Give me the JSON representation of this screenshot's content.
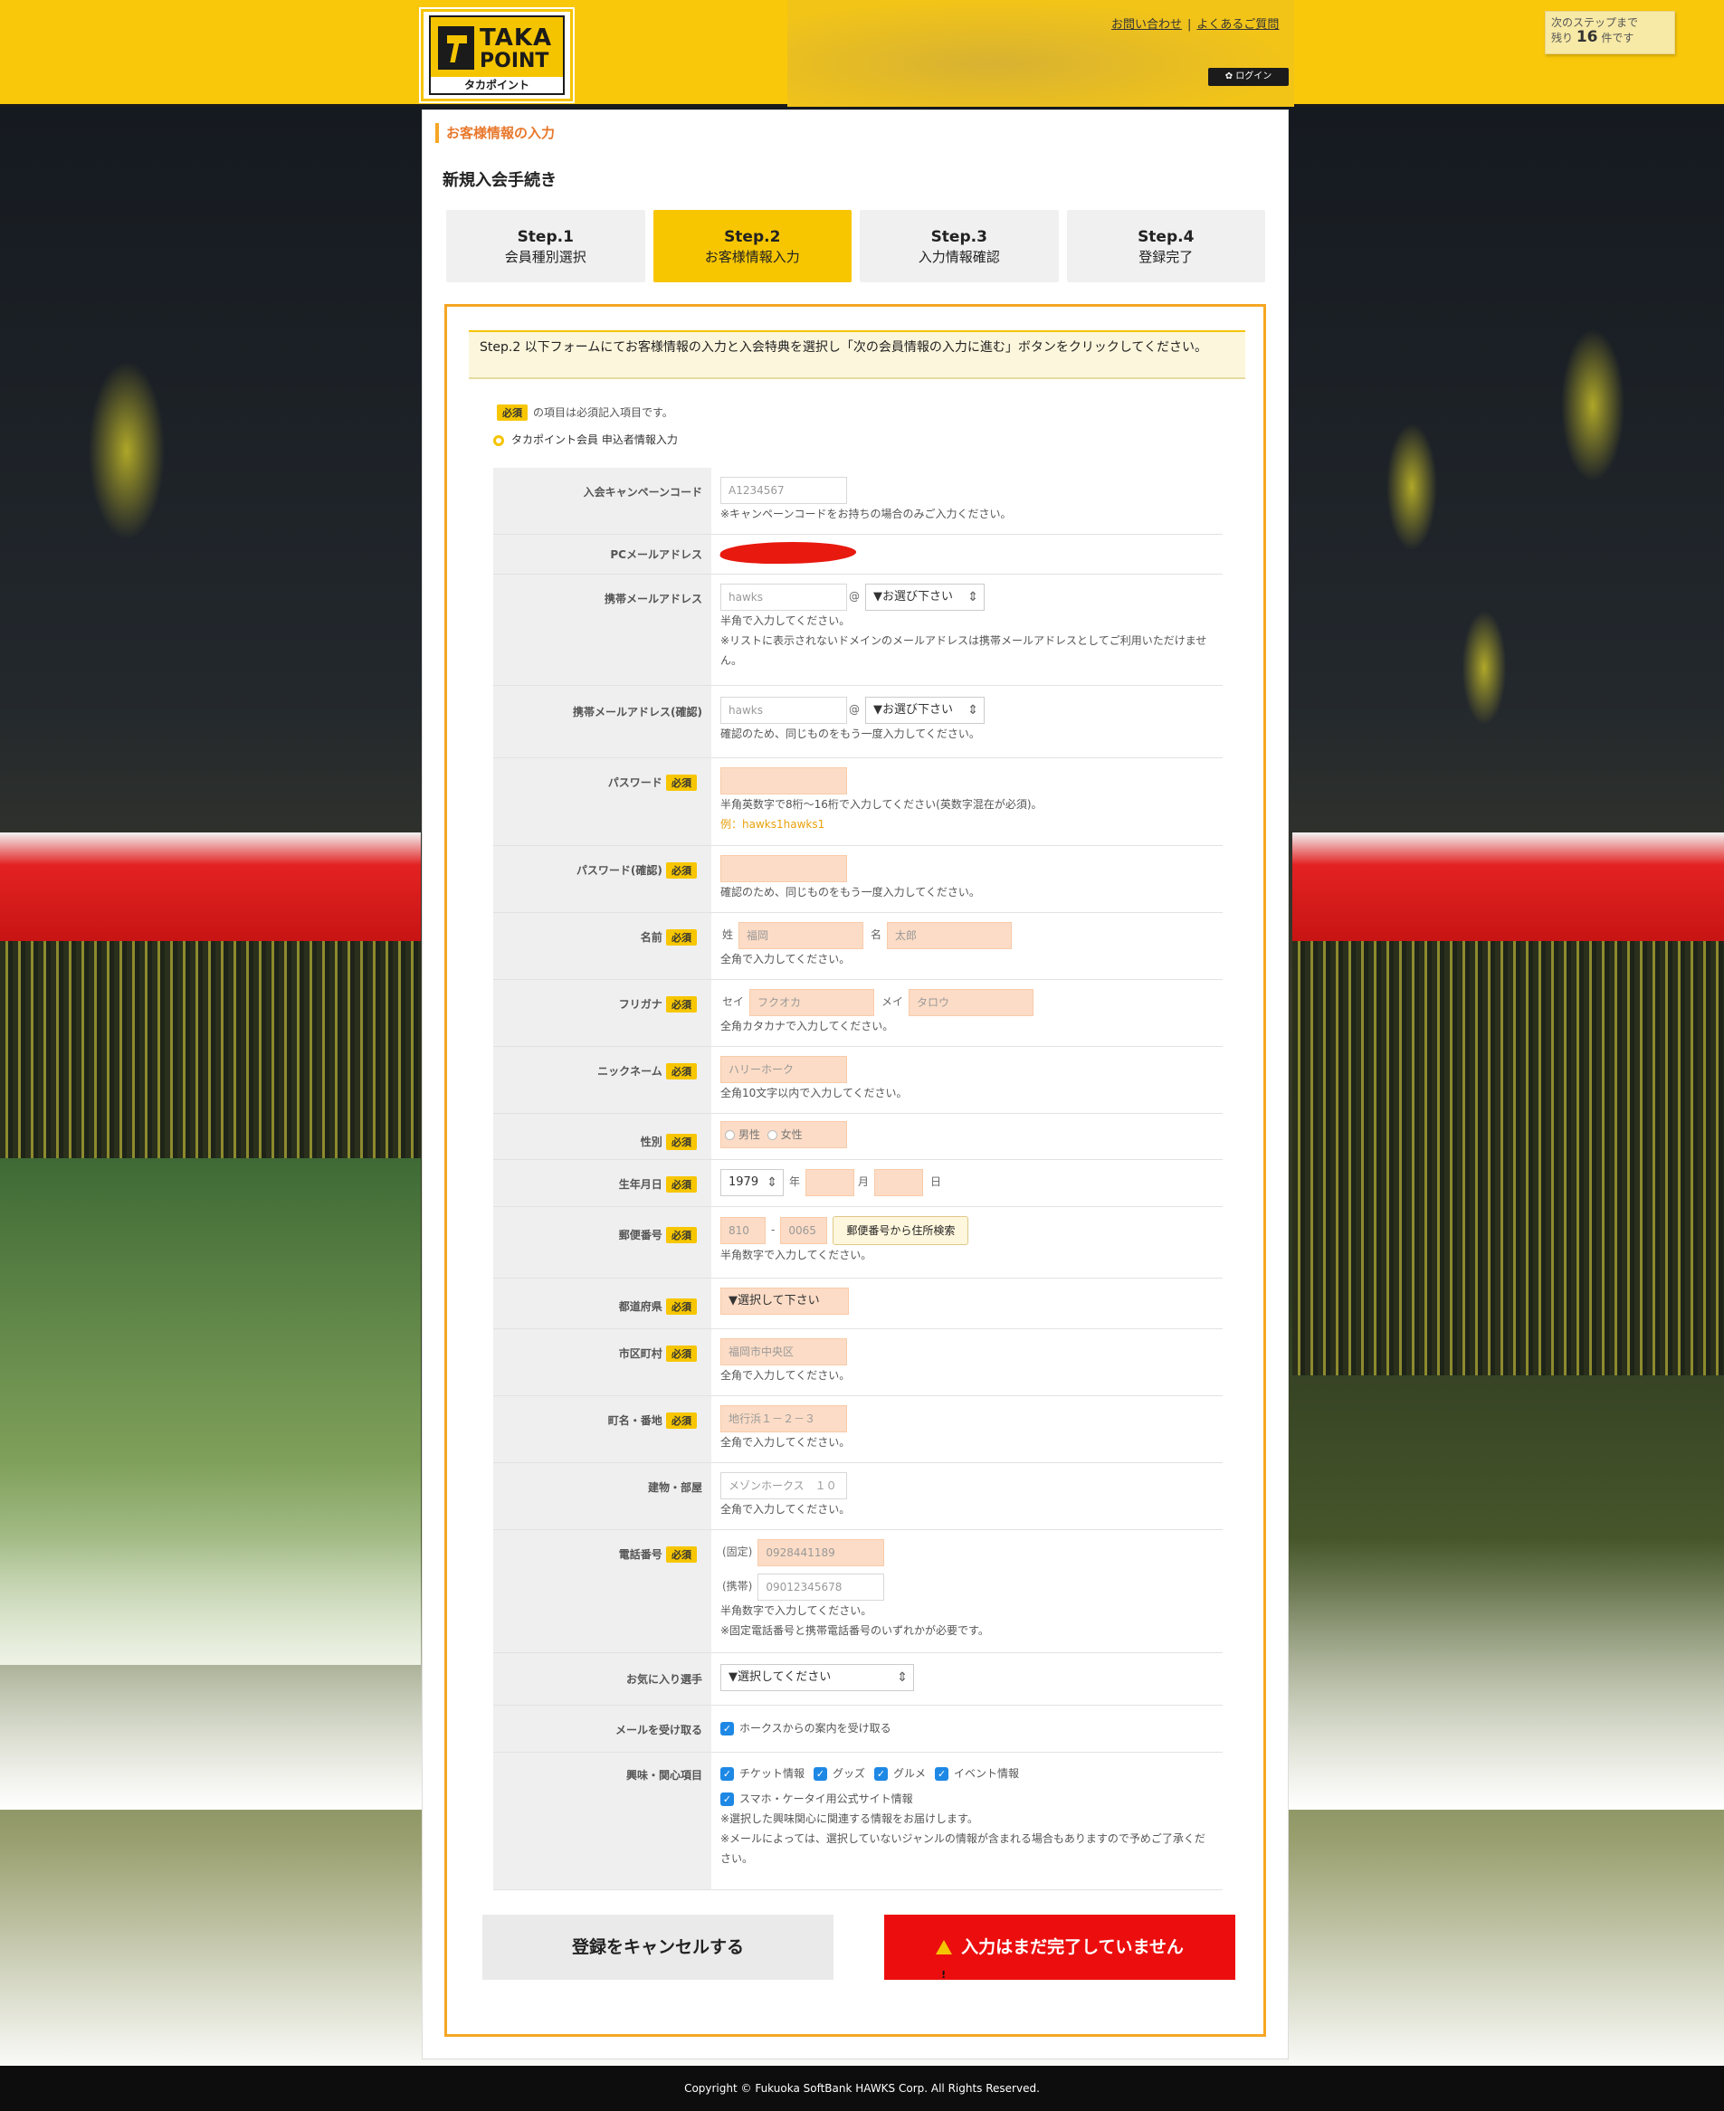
{
  "header": {
    "logo_line1": "TAKA",
    "logo_line2": "POINT",
    "logo_sub": "タカポイント",
    "link_contact": "お問い合わせ",
    "link_faq": "よくあるご質問",
    "login": "ログイン",
    "steps_note_pre": "次のステップまで",
    "steps_note_mid": "残り",
    "steps_note_num": "16",
    "steps_note_post": "件です"
  },
  "breadcrumb": "お客様情報の入力",
  "page_title": "新規入会手続き",
  "tabs": [
    {
      "step": "Step.1",
      "label": "会員種別選択",
      "active": false
    },
    {
      "step": "Step.2",
      "label": "お客様情報入力",
      "active": true
    },
    {
      "step": "Step.3",
      "label": "入力情報確認",
      "active": false
    },
    {
      "step": "Step.4",
      "label": "登録完了",
      "active": false
    }
  ],
  "info_text": "Step.2 以下フォームにてお客様情報の入力と入会特典を選択し「次の会員情報の入力に進む」ボタンをクリックしてください。",
  "required_badge": "必須",
  "required_note": "の項目は必須記入項目です。",
  "section_head": "タカポイント会員 申込者情報入力",
  "fields": {
    "campaign": {
      "label": "入会キャンペーンコード",
      "placeholder": "A1234567",
      "hint": "※キャンペーンコードをお持ちの場合のみご入力ください。"
    },
    "pc_mail": {
      "label": "PCメールアドレス"
    },
    "mobile_mail": {
      "label": "携帯メールアドレス",
      "placeholder": "hawks",
      "at": "@",
      "domain": "▼お選び下さい",
      "hint1": "半角で入力してください。",
      "hint2": "※リストに表示されないドメインのメールアドレスは携帯メールアドレスとしてご利用いただけません。"
    },
    "mobile_mail_confirm": {
      "label": "携帯メールアドレス(確認)",
      "placeholder": "hawks",
      "at": "@",
      "domain": "▼お選び下さい",
      "hint": "確認のため、同じものをもう一度入力してください。"
    },
    "password": {
      "label": "パスワード",
      "hint": "半角英数字で8桁〜16桁で入力してください(英数字混在が必須)。",
      "example": "例：hawks1hawks1"
    },
    "password_confirm": {
      "label": "パスワード(確認)",
      "hint": "確認のため、同じものをもう一度入力してください。"
    },
    "name": {
      "label": "名前",
      "sei": "姓",
      "sei_ph": "福岡",
      "mei": "名",
      "mei_ph": "太郎",
      "hint": "全角で入力してください。"
    },
    "kana": {
      "label": "フリガナ",
      "sei": "セイ",
      "sei_ph": "フクオカ",
      "mei": "メイ",
      "mei_ph": "タロウ",
      "hint": "全角カタカナで入力してください。"
    },
    "nickname": {
      "label": "ニックネーム",
      "placeholder": "ハリーホーク",
      "hint": "全角10文字以内で入力してください。"
    },
    "gender": {
      "label": "性別",
      "male": "男性",
      "female": "女性"
    },
    "birthday": {
      "label": "生年月日",
      "year": "1979",
      "year_unit": "年",
      "month_unit": "月",
      "day_unit": "日"
    },
    "zip": {
      "label": "郵便番号",
      "ph1": "810",
      "dash": "-",
      "ph2": "0065",
      "button": "郵便番号から住所検索",
      "hint": "半角数字で入力してください。"
    },
    "pref": {
      "label": "都道府県",
      "value": "▼選択して下さい"
    },
    "city": {
      "label": "市区町村",
      "placeholder": "福岡市中央区",
      "hint": "全角で入力してください。"
    },
    "street": {
      "label": "町名・番地",
      "placeholder": "地行浜１－２－３",
      "hint": "全角で入力してください。"
    },
    "building": {
      "label": "建物・部屋",
      "placeholder": "メゾンホークス　１０",
      "hint": "全角で入力してください。"
    },
    "phone": {
      "label": "電話番号",
      "fixed": "(固定)",
      "fixed_ph": "0928441189",
      "mobile": "(携帯)",
      "mobile_ph": "09012345678",
      "hint1": "半角数字で入力してください。",
      "hint2": "※固定電話番号と携帯電話番号のいずれかが必要です。"
    },
    "favorite": {
      "label": "お気に入り選手",
      "value": "▼選択してください"
    },
    "mail_receive": {
      "label": "メールを受け取る",
      "option": "ホークスからの案内を受け取る"
    },
    "interests": {
      "label": "興味・関心項目",
      "options": [
        "チケット情報",
        "グッズ",
        "グルメ",
        "イベント情報",
        "スマホ・ケータイ用公式サイト情報"
      ],
      "hint1": "※選択した興味関心に関連する情報をお届けします。",
      "hint2": "※メールによっては、選択していないジャンルの情報が含まれる場合もありますので予めご了承ください。"
    }
  },
  "buttons": {
    "cancel": "登録をキャンセルする",
    "submit": "入力はまだ完了していません"
  },
  "footer": "Copyright © Fukuoka SoftBank HAWKS Corp. All Rights Reserved."
}
